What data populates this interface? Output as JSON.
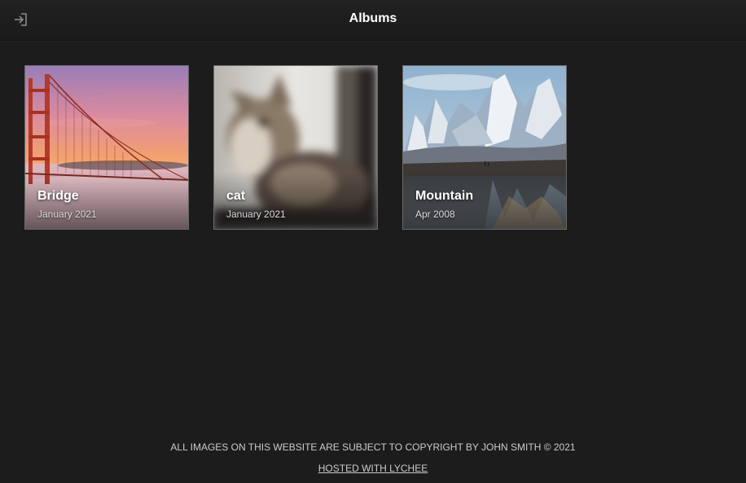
{
  "header": {
    "title": "Albums",
    "login_icon": "sign-in-icon"
  },
  "albums": [
    {
      "title": "Bridge",
      "date": "January 2021",
      "thumb_icon": "golden-gate-bridge-photo"
    },
    {
      "title": "cat",
      "date": "January 2021",
      "thumb_icon": "cat-photo"
    },
    {
      "title": "Mountain",
      "date": "Apr 2008",
      "thumb_icon": "mountain-painting-photo"
    }
  ],
  "footer": {
    "copyright": "ALL IMAGES ON THIS WEBSITE ARE SUBJECT TO COPYRIGHT BY JOHN SMITH © 2021",
    "hosted_link": "HOSTED WITH LYCHEE"
  },
  "colors": {
    "background": "#1c1c1c",
    "header": "#1f1f1f",
    "text": "#ffffff",
    "muted_text": "#cccccc"
  }
}
